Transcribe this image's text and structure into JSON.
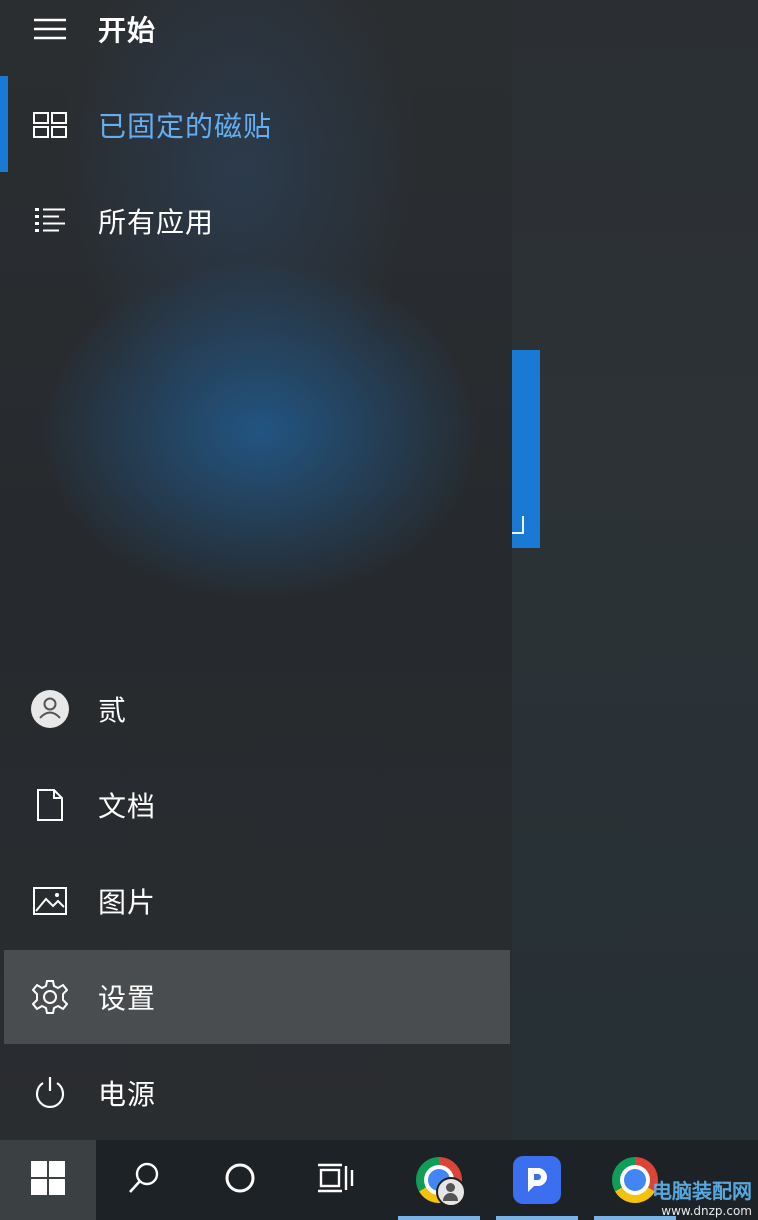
{
  "start_menu": {
    "header_label": "开始",
    "nav": [
      {
        "label": "已固定的磁贴",
        "icon": "tiles-icon",
        "active": true
      },
      {
        "label": "所有应用",
        "icon": "list-icon"
      }
    ],
    "bottom": [
      {
        "label": "贰",
        "icon": "user-avatar-icon"
      },
      {
        "label": "文档",
        "icon": "document-icon"
      },
      {
        "label": "图片",
        "icon": "pictures-icon"
      },
      {
        "label": "设置",
        "icon": "gear-icon",
        "hovered": true
      },
      {
        "label": "电源",
        "icon": "power-icon"
      }
    ]
  },
  "taskbar": {
    "items": [
      {
        "name": "start",
        "icon": "windows-logo-icon"
      },
      {
        "name": "search",
        "icon": "search-icon"
      },
      {
        "name": "cortana",
        "icon": "circle-icon"
      },
      {
        "name": "task-view",
        "icon": "task-view-icon"
      },
      {
        "name": "chrome",
        "icon": "chrome-icon",
        "running": true
      },
      {
        "name": "app",
        "icon": "r-app-icon",
        "running": true
      },
      {
        "name": "chrome-2",
        "icon": "chrome-icon",
        "running": true
      }
    ]
  },
  "watermark": {
    "line1": "电脑装配网",
    "line2": "www.dnzp.com"
  },
  "colors": {
    "accent": "#1a7ad3",
    "active_text": "#66aef0",
    "hover_row": "#4a4d50",
    "taskbar": "#1d2226"
  }
}
